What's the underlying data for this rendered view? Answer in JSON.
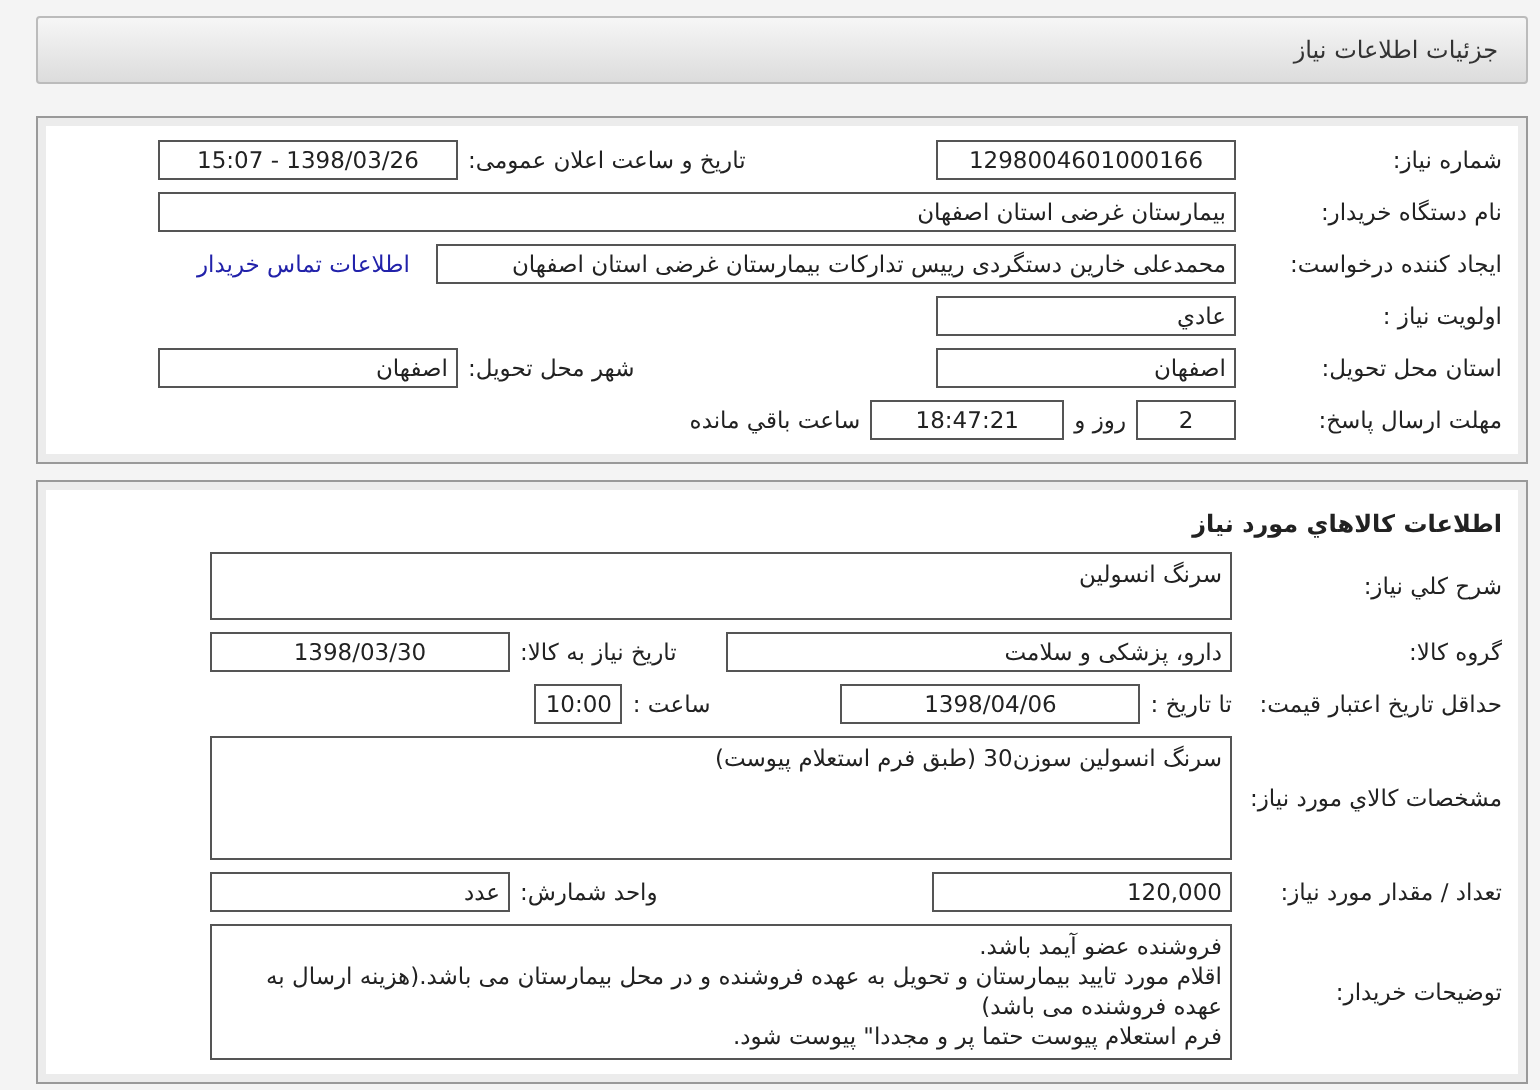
{
  "header": {
    "title": "جزئیات اطلاعات نیاز"
  },
  "panels": [
    {
      "lines": [
        {
          "kind": "pair",
          "parts": [
            {
              "kind": "label",
              "text": "شماره نیاز:"
            },
            {
              "kind": "value",
              "text": "1298004601000166"
            },
            {
              "kind": "label",
              "text": "تاریخ و ساعت اعلان عمومی:"
            },
            {
              "kind": "value",
              "text": "1398/03/26 - 15:07"
            }
          ]
        },
        {
          "kind": "inline",
          "parts": [
            {
              "kind": "label",
              "text": "نام دستگاه خریدار:"
            },
            {
              "kind": "field_fill",
              "text": "بیمارستان غرضی استان اصفهان"
            }
          ]
        },
        {
          "kind": "inline",
          "parts": [
            {
              "kind": "label",
              "text": "ایجاد کننده درخواست:"
            },
            {
              "kind": "field_long",
              "text": "محمدعلی خارین دستگردی رییس تدارکات بیمارستان غرضی استان اصفهان"
            },
            {
              "kind": "link",
              "text": "اطلاعات تماس خریدار"
            }
          ]
        },
        {
          "kind": "inline",
          "parts": [
            {
              "kind": "label",
              "text": "اولویت نیاز :"
            },
            {
              "kind": "field",
              "text": "عادي"
            }
          ]
        },
        {
          "kind": "pair",
          "parts": [
            {
              "kind": "label",
              "text": "استان محل تحویل:"
            },
            {
              "kind": "field",
              "text": "اصفهان"
            },
            {
              "kind": "label",
              "text": "شهر محل تحویل:"
            },
            {
              "kind": "field",
              "text": "اصفهان"
            }
          ]
        },
        {
          "kind": "inline",
          "parts": [
            {
              "kind": "label",
              "text": "مهلت ارسال پاسخ:"
            },
            {
              "kind": "value_small",
              "text": "2"
            },
            {
              "kind": "text",
              "text": "روز و"
            },
            {
              "kind": "value_mid",
              "text": "18:47:21"
            },
            {
              "kind": "text",
              "text": "ساعت باقي مانده"
            }
          ]
        }
      ]
    },
    {
      "title": "اطلاعات کالاهاي مورد نیاز",
      "lines": [
        {
          "kind": "inline",
          "parts": [
            {
              "kind": "label",
              "text": "شرح کلي نیاز:"
            },
            {
              "kind": "box",
              "text": "سرنگ انسولین"
            }
          ]
        },
        {
          "kind": "pair",
          "parts": [
            {
              "kind": "label",
              "text": "گروه کالا:"
            },
            {
              "kind": "field_mid",
              "text": "دارو، پزشکی و سلامت"
            },
            {
              "kind": "label",
              "text": "تاریخ نیاز به کالا:"
            },
            {
              "kind": "value",
              "text": "1398/03/30"
            }
          ]
        },
        {
          "kind": "inline",
          "parts": [
            {
              "kind": "label",
              "text": "حداقل تاریخ اعتبار قیمت:"
            },
            {
              "kind": "text",
              "text": "تا تاریخ :"
            },
            {
              "kind": "value",
              "text": "1398/04/06"
            },
            {
              "kind": "text_far",
              "text": "ساعت :"
            },
            {
              "kind": "value_tiny",
              "text": "10:00"
            }
          ]
        },
        {
          "kind": "inline",
          "parts": [
            {
              "kind": "label",
              "text": "مشخصات کالاي مورد نیاز:"
            },
            {
              "kind": "box_tall",
              "text": "سرنگ انسولین سوزن30 (طبق فرم استعلام پیوست)"
            }
          ]
        },
        {
          "kind": "pair",
          "parts": [
            {
              "kind": "label",
              "text": "تعداد / مقدار مورد نیاز:"
            },
            {
              "kind": "field",
              "text": "120,000"
            },
            {
              "kind": "label",
              "text": "واحد شمارش:"
            },
            {
              "kind": "field",
              "text": "عدد"
            }
          ]
        },
        {
          "kind": "inline",
          "parts": [
            {
              "kind": "label",
              "text": "توضیحات خریدار:"
            },
            {
              "kind": "box_tall",
              "text": "فروشنده عضو آیمد باشد.\nاقلام مورد تایید بیمارستان و تحویل به عهده فروشنده و در محل بیمارستان می باشد.(هزینه ارسال به عهده فروشنده می باشد)\nفرم استعلام پیوست حتما پر و مجددا\" پیوست شود."
            }
          ]
        }
      ]
    }
  ]
}
